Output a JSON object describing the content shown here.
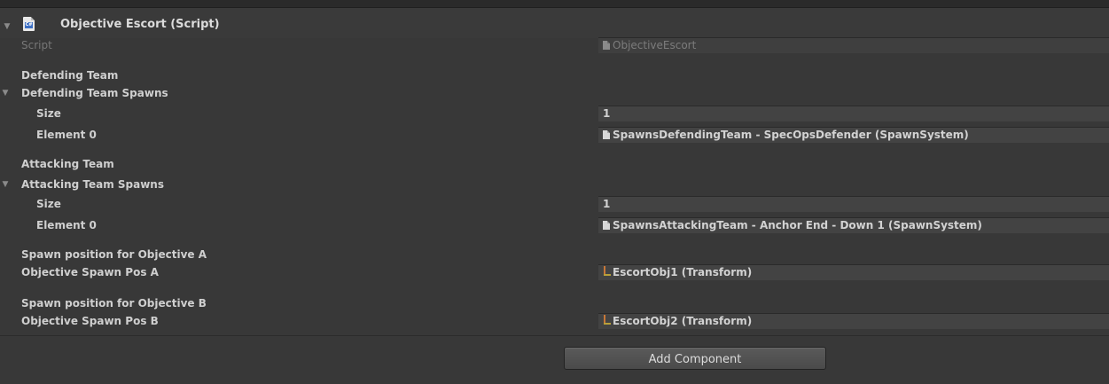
{
  "component": {
    "title": "Objective Escort (Script)"
  },
  "script_row": {
    "label": "Script",
    "value": "ObjectiveEscort"
  },
  "defending": {
    "header": "Defending Team",
    "array_label": "Defending Team Spawns",
    "size_label": "Size",
    "size_value": "1",
    "element_label": "Element 0",
    "element_value": "SpawnsDefendingTeam - SpecOpsDefender (SpawnSystem)"
  },
  "attacking": {
    "header": "Attacking Team",
    "array_label": "Attacking Team Spawns",
    "size_label": "Size",
    "size_value": "1",
    "element_label": "Element 0",
    "element_value": "SpawnsAttackingTeam - Anchor End - Down 1 (SpawnSystem)"
  },
  "objective_a": {
    "header": "Spawn position for Objective A",
    "label": "Objective Spawn Pos A",
    "value": "EscortObj1 (Transform)"
  },
  "objective_b": {
    "header": "Spawn position for Objective B",
    "label": "Objective Spawn Pos B",
    "value": "EscortObj2 (Transform)"
  },
  "footer": {
    "add_component_label": "Add Component"
  },
  "icons": {
    "component_icon": "csharp-script-icon",
    "script_file_icon": "script-file-icon",
    "transform_icon": "transform-icon",
    "fold_icon": "foldout-arrow-icon"
  },
  "colors": {
    "panel_background": "#383838",
    "field_background": "#434343",
    "label_text": "#cfcfcf",
    "cs_icon_blue": "#3c6fc4",
    "transform_orange": "#c87838"
  }
}
